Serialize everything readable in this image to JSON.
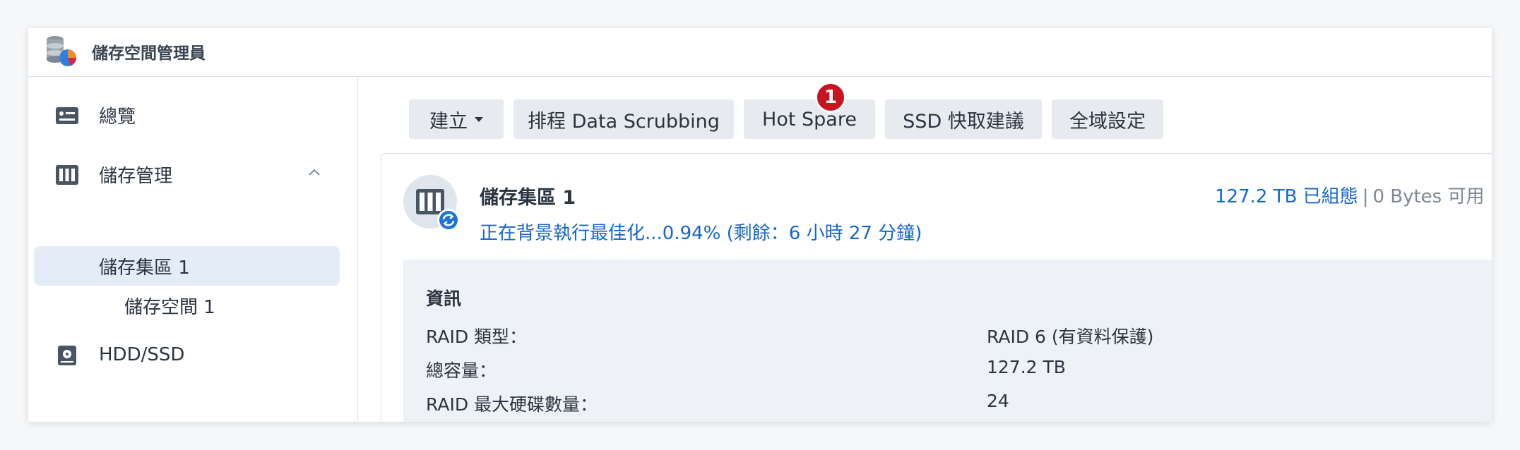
{
  "app": {
    "title": "儲存空間管理員"
  },
  "sidebar": {
    "items": [
      {
        "label": "總覽",
        "icon": "overview-icon"
      },
      {
        "label": "儲存管理",
        "icon": "storage-icon"
      },
      {
        "label": "儲存集區 1"
      },
      {
        "label": "儲存空間 1"
      },
      {
        "label": "HDD/SSD",
        "icon": "hdd-icon"
      }
    ]
  },
  "toolbar": {
    "create": "建立",
    "scrubbing": "排程 Data Scrubbing",
    "hot_spare": "Hot Spare",
    "hot_spare_badge": "1",
    "ssd_cache": "SSD 快取建議",
    "global_settings": "全域設定"
  },
  "pool": {
    "title": "儲存集區 1",
    "status": "正在背景執行最佳化...0.94% (剩餘：6 小時 27 分鐘)",
    "configured": "127.2 TB 已組態",
    "separator": "|",
    "available": "0 Bytes 可用",
    "info": {
      "title": "資訊",
      "rows": [
        {
          "key": "RAID 類型：",
          "value": "RAID 6 (有資料保護)"
        },
        {
          "key": "總容量：",
          "value": "127.2 TB"
        },
        {
          "key": "RAID 最大硬碟數量：",
          "value": "24"
        }
      ]
    }
  },
  "colors": {
    "accent": "#1667c9",
    "badge": "#c7141e",
    "active_bg": "#e3ecf7",
    "panel_bg": "#eef2f6"
  }
}
